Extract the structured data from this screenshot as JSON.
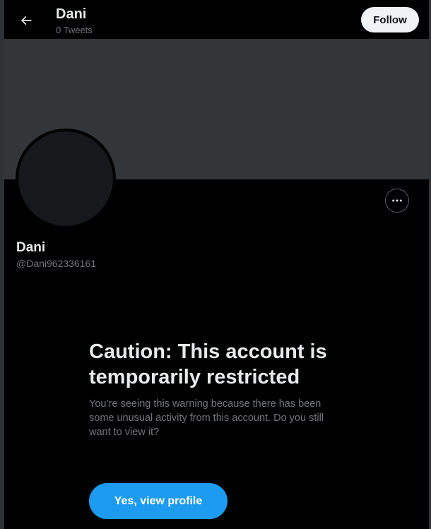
{
  "header": {
    "name": "Dani",
    "tweet_count": "0 Tweets",
    "follow_label": "Follow"
  },
  "profile": {
    "name": "Dani",
    "handle": "@Dani962336161"
  },
  "warning": {
    "title": "Caution: This account is temporarily restricted",
    "body": "You’re seeing this warning because there has been some unusual activity from this account. Do you still want to view it?",
    "button_label": "Yes, view profile"
  },
  "colors": {
    "accent": "#1d9bf0",
    "background": "#000000",
    "banner": "#333639"
  },
  "icons": {
    "back": "arrow-left-icon",
    "more": "more-horizontal-icon"
  }
}
